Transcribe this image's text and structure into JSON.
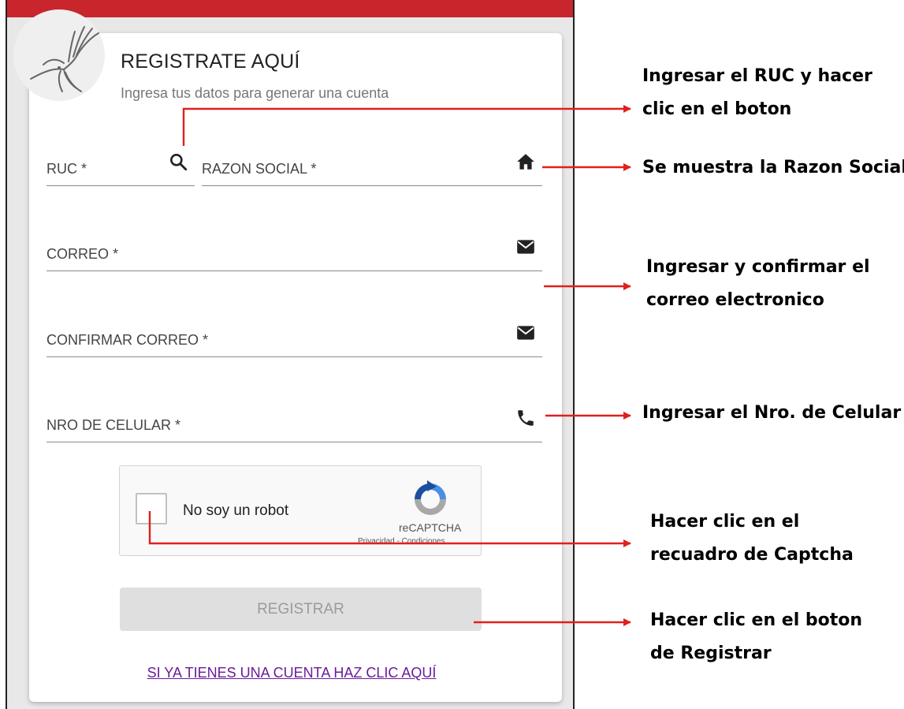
{
  "form": {
    "title": "REGISTRATE AQUÍ",
    "subtitle": "Ingresa tus datos para generar una cuenta",
    "ruc_label": "RUC *",
    "razon_label": "RAZON SOCIAL *",
    "correo_label": "CORREO *",
    "confirmar_label": "CONFIRMAR CORREO *",
    "celular_label": "NRO DE CELULAR *",
    "register_label": "REGISTRAR",
    "login_link": "SI YA TIENES UNA CUENTA HAZ CLIC AQUÍ",
    "icons": [
      "search-icon",
      "home-icon",
      "email-icon",
      "email-icon",
      "phone-icon"
    ]
  },
  "captcha": {
    "label": "No soy un robot",
    "brand": "reCAPTCHA",
    "links": "Privacidad - Condiciones"
  },
  "annotations": {
    "ruc_line1": "Ingresar el RUC y hacer",
    "ruc_line2": "clic en el boton",
    "razon": "Se muestra la Razon Social",
    "correo_line1": "Ingresar y confirmar el",
    "correo_line2": "correo electronico",
    "celular": "Ingresar el Nro. de Celular",
    "captcha_line1": "Hacer clic en el",
    "captcha_line2": "recuadro de Captcha",
    "register_line1": "Hacer clic en el boton",
    "register_line2": "de Registrar"
  },
  "colors": {
    "top_bar": "#c8252c",
    "arrow": "#e0201d",
    "link": "#6a1b9a"
  }
}
